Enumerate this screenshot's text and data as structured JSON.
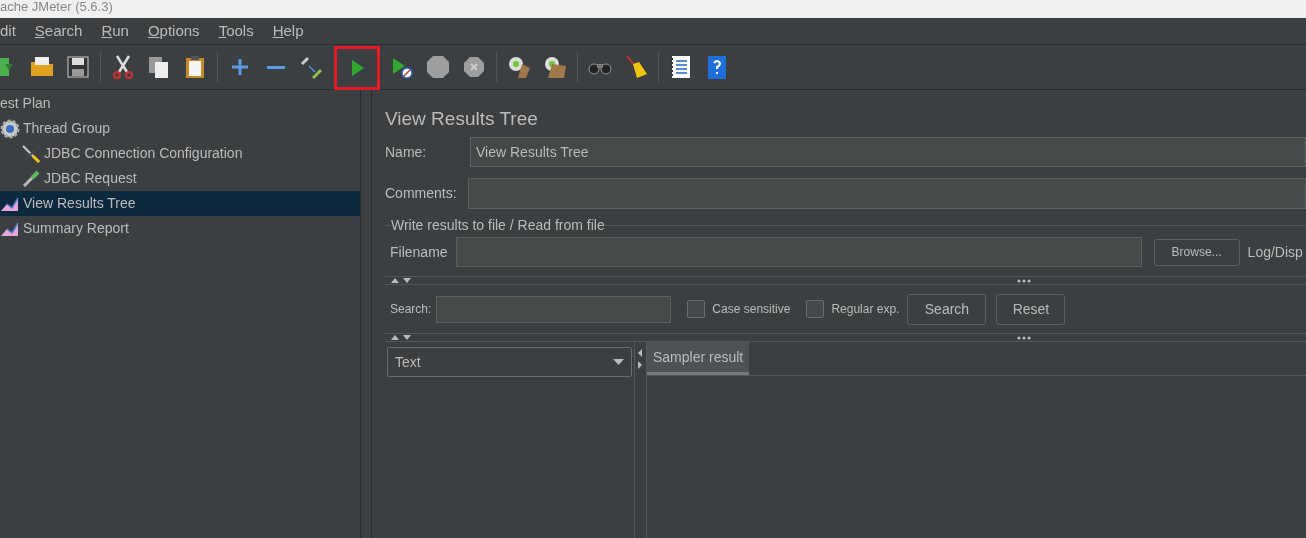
{
  "window": {
    "title": "ache JMeter (5.6.3)"
  },
  "menu": [
    {
      "label": "dit",
      "mnemonic": false
    },
    {
      "label": "Search",
      "mnemonic": true
    },
    {
      "label": "Run",
      "mnemonic": true
    },
    {
      "label": "Options",
      "mnemonic": true
    },
    {
      "label": "Tools",
      "mnemonic": true
    },
    {
      "label": "Help",
      "mnemonic": true
    }
  ],
  "toolbar": [
    {
      "kind": "open",
      "highlighted": false
    },
    {
      "kind": "folder",
      "highlighted": false
    },
    {
      "kind": "save",
      "highlighted": false
    },
    {
      "kind": "sep"
    },
    {
      "kind": "cut",
      "highlighted": false
    },
    {
      "kind": "copy",
      "highlighted": false
    },
    {
      "kind": "paste",
      "highlighted": false
    },
    {
      "kind": "sep"
    },
    {
      "kind": "plus",
      "highlighted": false
    },
    {
      "kind": "minus",
      "highlighted": false
    },
    {
      "kind": "toggle",
      "highlighted": false
    },
    {
      "kind": "start",
      "highlighted": true
    },
    {
      "kind": "start-no-pause",
      "highlighted": false
    },
    {
      "kind": "stop",
      "highlighted": false
    },
    {
      "kind": "shutdown",
      "highlighted": false
    },
    {
      "kind": "sep"
    },
    {
      "kind": "clear",
      "highlighted": false
    },
    {
      "kind": "clear-all",
      "highlighted": false
    },
    {
      "kind": "sep"
    },
    {
      "kind": "search",
      "highlighted": false
    },
    {
      "kind": "broom",
      "highlighted": false
    },
    {
      "kind": "sep"
    },
    {
      "kind": "functions",
      "highlighted": false
    },
    {
      "kind": "help",
      "highlighted": false
    }
  ],
  "tree": [
    {
      "label": "est Plan",
      "selected": false,
      "children": [
        {
          "label": "Thread Group",
          "kind": "gear",
          "selected": false,
          "children": [
            {
              "label": "JDBC Connection Configuration",
              "kind": "config",
              "selected": false
            },
            {
              "label": "JDBC Request",
              "kind": "sampler",
              "selected": false
            }
          ]
        },
        {
          "label": "View Results Tree",
          "kind": "listener",
          "selected": true
        },
        {
          "label": "Summary Report",
          "kind": "listener",
          "selected": false
        }
      ]
    }
  ],
  "panel": {
    "title": "View Results Tree",
    "name_label": "Name:",
    "name_value": "View Results Tree",
    "comments_label": "Comments:",
    "file_group": "Write results to file / Read from file",
    "filename_label": "Filename",
    "browse": "Browse...",
    "log_label": "Log/Disp",
    "search_label": "Search:",
    "checkboxes": [
      {
        "label": "Case sensitive",
        "checked": false
      },
      {
        "label": "Regular exp.",
        "checked": false
      }
    ],
    "search_button": "Search",
    "reset_button": "Reset",
    "renderer": "Text",
    "tabs": [
      {
        "label": "Sampler result",
        "selected": true
      }
    ]
  }
}
